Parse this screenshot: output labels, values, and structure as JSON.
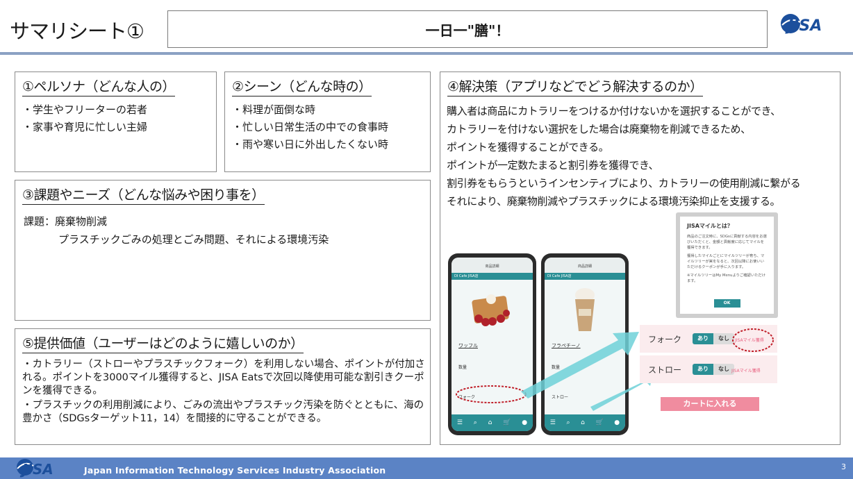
{
  "slide": {
    "heading": "サマリシート①",
    "title": "一日一\"膳\"！",
    "logo_text": "JISA",
    "page_number": "3",
    "footer": "Japan Information Technology Services Industry Association"
  },
  "persona": {
    "title": "①ペルソナ（どんな人の）",
    "items": [
      "学生やフリーターの若者",
      "家事や育児に忙しい主婦"
    ]
  },
  "scene": {
    "title": "②シーン（どんな時の）",
    "items": [
      "料理が面倒な時",
      "忙しい日常生活の中での食事時",
      "雨や寒い日に外出したくない時"
    ]
  },
  "issues": {
    "title": "③課題やニーズ（どんな悩みや困り事を）",
    "line1": "課題：廃棄物削減",
    "line2": "プラスチックごみの処理とごみ問題、それによる環境汚染"
  },
  "value": {
    "title": "⑤提供価値（ユーザーはどのように嬉しいのか）",
    "p1": "・カトラリー（ストローやプラスチックフォーク）を利用しない場合、ポイントが付加される。ポイントを3000マイル獲得すると、JISA Eatsで次回以降使用可能な割引きクーポンを獲得できる。",
    "p2": "・プラスチックの利用削減により、ごみの流出やプラスチック汚染を防ぐとともに、海の豊かさ（SDGsターゲット11，14）を間接的に守ることができる。"
  },
  "solution": {
    "title": "④解決策（アプリなどでどう解決するのか）",
    "lines": [
      "購入者は商品にカトラリーをつけるか付けないかを選択することができ、",
      "カトラリーを付けない選択をした場合は廃棄物を削減できるため、",
      "ポイントを獲得することができる。",
      "ポイントが一定数たまると割引券を獲得でき、",
      "割引券をもらうというインセンティブにより、カトラリーの使用削減に繋がる",
      "それにより、廃棄物削減やプラスチックによる環境汚染抑止を支援する。"
    ]
  },
  "mockups": {
    "phone1": {
      "product": "ワッフル",
      "qty_label": "数量",
      "option_label": "フォーク",
      "shop": "DI Cafe JISA店",
      "header": "商品詳細"
    },
    "phone2": {
      "product": "フラペチーノ",
      "qty_label": "数量",
      "option_label": "ストロー",
      "shop": "DI Cafe JISA店",
      "header": "商品詳細"
    },
    "dialog": {
      "title": "JISAマイルとは？",
      "body1": "商品のご注文時に、SDGsに貢献する内容をお選びいただくと、金額と貢献度に応じてマイルを獲得できます。",
      "body2": "獲得したマイルごとにマイルツリーが育ち、マイルツリーが実をなると、次回以降にお使いいただけるクーポンが手に入ります。",
      "body3": "※マイルツリーはMy Menuよりご確認いただけます。",
      "ok": "OK"
    },
    "fork_row": {
      "label": "フォーク",
      "yes": "あり",
      "no": "なし",
      "mile": "JISAマイル獲得"
    },
    "straw_row": {
      "label": "ストロー",
      "yes": "あり",
      "no": "なし",
      "mile": "JISAマイル獲得"
    },
    "cart_button": "カートに入れる"
  },
  "colors": {
    "accent": "#2a8f95",
    "footer": "#5b83c5",
    "pink": "#f08c9f",
    "arrow": "#6fd1d8"
  }
}
